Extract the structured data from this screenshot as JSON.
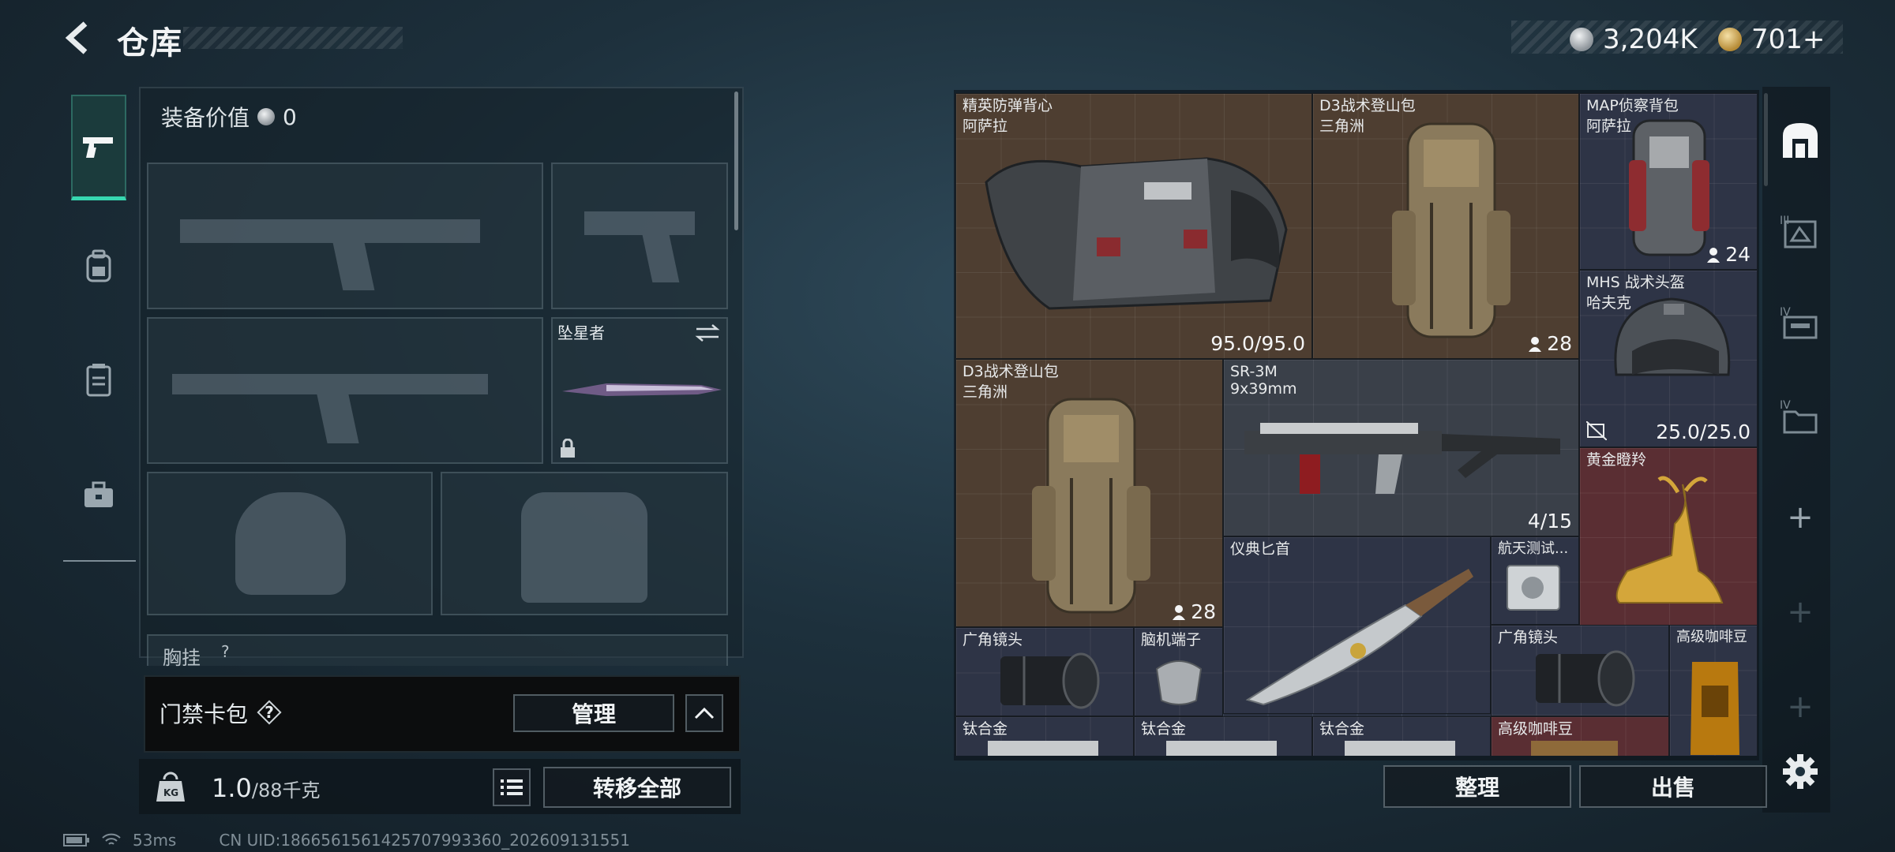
{
  "header": {
    "title": "仓库"
  },
  "currency": [
    {
      "icon": "silver-coin-icon",
      "amount": "3,204K"
    },
    {
      "icon": "gold-coin-icon",
      "amount": "701+"
    }
  ],
  "nav": {
    "items": [
      {
        "icon": "pistol-icon",
        "active": true
      },
      {
        "icon": "backpack-icon",
        "active": false
      },
      {
        "icon": "vest-icon",
        "active": false
      },
      {
        "icon": "toolbox-icon",
        "active": false
      }
    ]
  },
  "loadout": {
    "value_label": "装备价值",
    "value": "0",
    "melee_slot_label": "坠星者",
    "chest_rig_label": "胸挂",
    "chest_rig_badge": "?"
  },
  "keycard": {
    "label": "门禁卡包",
    "help": "?",
    "manage_label": "管理"
  },
  "bottom": {
    "weight_icon_text": "KG",
    "weight_current": "1.0",
    "weight_max": "/88千克",
    "transfer_all_label": "转移全部"
  },
  "status": {
    "latency": "53ms",
    "uid": "CN UID:1866561561425707993360_202609131551"
  },
  "stash": {
    "items": [
      {
        "name": "精英防弹背心",
        "origin": "阿萨拉",
        "value": "95.0/95.0"
      },
      {
        "name": "D3战术登山包",
        "origin": "三角洲",
        "count": "28"
      },
      {
        "name": "MAP侦察背包",
        "origin": "阿萨拉",
        "count": "24"
      },
      {
        "name": "MHS 战术头盔",
        "origin": "哈夫克",
        "value": "25.0/25.0"
      },
      {
        "name": "D3战术登山包",
        "origin": "三角洲",
        "count": "28"
      },
      {
        "name": "SR-3M",
        "origin": "9x39mm",
        "value": "4/15"
      },
      {
        "name": "黄金瞪羚"
      },
      {
        "name": "仪典匕首"
      },
      {
        "name": "航天测试..."
      },
      {
        "name": "广角镜头"
      },
      {
        "name": "脑机端子"
      },
      {
        "name": "广角镜头"
      },
      {
        "name": "高级咖啡豆"
      },
      {
        "name": "钛合金"
      },
      {
        "name": "钛合金"
      },
      {
        "name": "钛合金"
      },
      {
        "name": "高级咖啡豆"
      }
    ],
    "sort_label": "整理",
    "sell_label": "出售"
  },
  "side_tabs": {
    "plus": "+",
    "tiers": [
      "III",
      "IV",
      "IV"
    ]
  }
}
